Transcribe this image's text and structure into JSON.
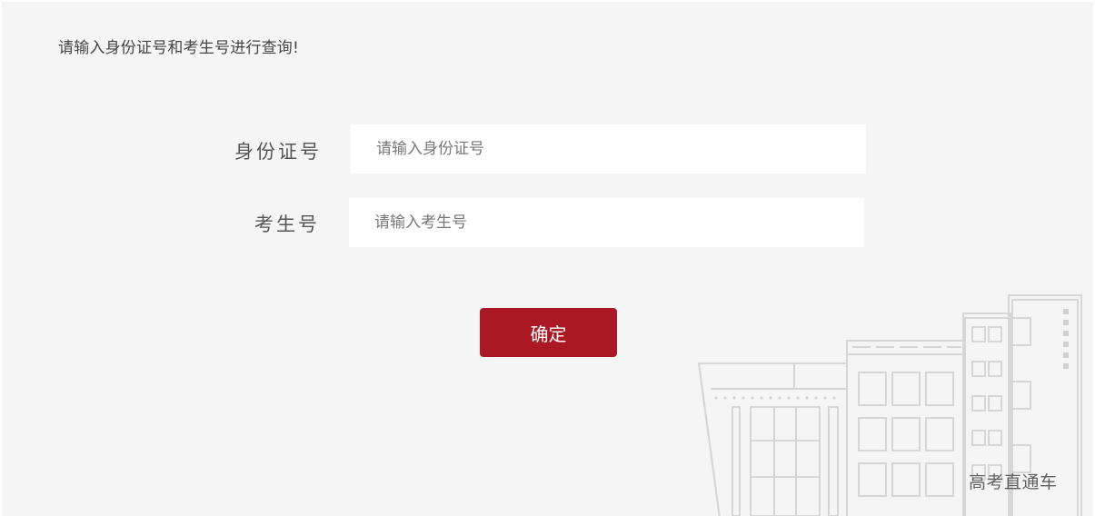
{
  "instruction_text": "请输入身份证号和考生号进行查询!",
  "form": {
    "id_label": "身份证号",
    "id_placeholder": "请输入身份证号",
    "exam_label": "考生号",
    "exam_placeholder": "请输入考生号",
    "confirm_label": "确定"
  },
  "watermark": {
    "caption": "高考直通车",
    "building_icon": "school-building-illustration"
  },
  "colors": {
    "background": "#f5f5f5",
    "accent": "#aa1824",
    "input_background": "#ffffff"
  }
}
